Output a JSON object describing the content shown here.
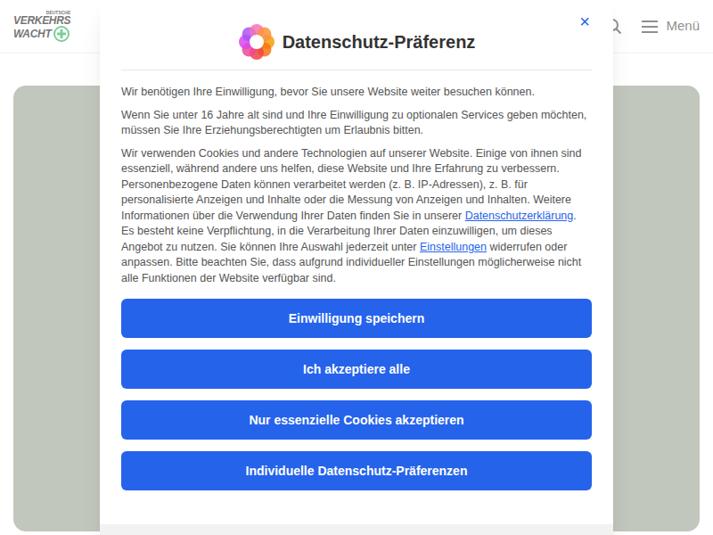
{
  "header": {
    "logo": {
      "small": "DEUTSCHE",
      "line1": "VERKEHRS",
      "line2": "WACHT"
    },
    "menu_label": "Menü"
  },
  "dialog": {
    "title": "Datenschutz-Präferenz",
    "close": "×",
    "paragraphs": [
      [
        {
          "text": "Wir benötigen Ihre Einwilligung, bevor Sie unsere Website weiter besuchen können.",
          "link": false
        }
      ],
      [
        {
          "text": "Wenn Sie unter 16 Jahre alt sind und Ihre Einwilligung zu optionalen Services geben möchten, müssen Sie Ihre Erziehungsberechtigten um Erlaubnis bitten.",
          "link": false
        }
      ],
      [
        {
          "text": "Wir verwenden Cookies und andere Technologien auf unserer Website. Einige von ihnen sind essenziell, während andere uns helfen, diese Website und Ihre Erfahrung zu verbessern. Personenbezogene Daten können verarbeitet werden (z. B. IP-Adressen), z. B. für personalisierte Anzeigen und Inhalte oder die Messung von Anzeigen und Inhalten. Weitere Informationen über die Verwendung Ihrer Daten finden Sie in unserer ",
          "link": false
        },
        {
          "text": "Datenschutzerklärung",
          "link": true
        },
        {
          "text": ". Es besteht keine Verpflichtung, in die Verarbeitung Ihrer Daten einzuwilligen, um dieses Angebot zu nutzen. Sie können Ihre Auswahl jederzeit unter ",
          "link": false
        },
        {
          "text": "Einstellungen",
          "link": true
        },
        {
          "text": " widerrufen oder anpassen. Bitte beachten Sie, dass aufgrund individueller Einstellungen möglicherweise nicht alle Funktionen der Website verfügbar sind.",
          "link": false
        }
      ]
    ],
    "buttons": [
      "Einwilligung speichern",
      "Ich akzeptiere alle",
      "Nur essenzielle Cookies akzeptieren",
      "Individuelle Datenschutz-Präferenzen"
    ]
  }
}
